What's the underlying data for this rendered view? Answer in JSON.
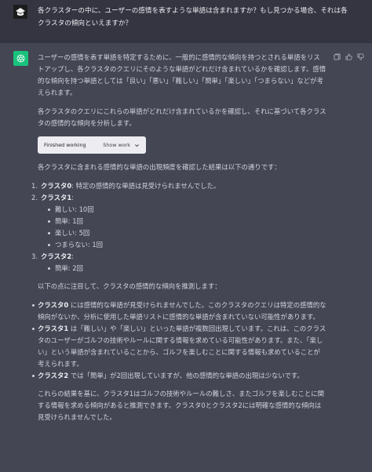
{
  "user": {
    "question": "各クラスターの中に、ユーザーの感情を表すような単語は含まれますか？もし見つかる場合、それは各クラスタの傾向といえますか？"
  },
  "assistant": {
    "intro": "ユーザーの感情を表す単語を特定するために、一般的に感情的な傾向を持つとされる単語をリストアップし、各クラスタのクエリにそのような単語がどれだけ含まれているかを確認します。感情的な傾向を持つ単語としては「良い」「悪い」「難しい」「簡単」「楽しい」「つまらない」などが考えられます。",
    "method": "各クラスタのクエリにこれらの単語がどれだけ含まれているかを確認し、それに基づいて各クラスタの感情的な傾向を分析します。",
    "work_button": {
      "label": "Finished working",
      "show_label": "Show work"
    },
    "results_intro": "各クラスタに含まれる感情的な単語の出現頻度を確認した結果は以下の通りです：",
    "clusters": [
      {
        "num": "1.",
        "name": "クラスタ0",
        "desc": ": 特定の感情的な単語は見受けられませんでした。",
        "words": []
      },
      {
        "num": "2.",
        "name": "クラスタ1",
        "desc": ":",
        "words": [
          "難しい: 10回",
          "簡単: 1回",
          "楽しい: 5回",
          "つまらない: 1回"
        ]
      },
      {
        "num": "3.",
        "name": "クラスタ2",
        "desc": ":",
        "words": [
          "簡単: 2回"
        ]
      }
    ],
    "analysis_intro": "以下の点に注目して、クラスタの感情的な傾向を推測します：",
    "analysis": [
      {
        "name": "クラスタ0",
        "text": " には感情的な単語が見受けられませんでした。このクラスタのクエリは特定の感情的な傾向がないか、分析に使用した単語リストに感情的な単語が含まれていない可能性があります。"
      },
      {
        "name": "クラスタ1",
        "text": " は「難しい」や「楽しい」といった単語が複数回出現しています。これは、このクラスタのユーザーがゴルフの技術やルールに関する情報を求めている可能性があります。また、「楽しい」という単語が含まれていることから、ゴルフを楽しむことに関する情報も求めていることが考えられます。"
      },
      {
        "name": "クラスタ2",
        "text": " では「簡単」が2回出現していますが、他の感情的な単語の出現は少ないです。"
      }
    ],
    "conclusion": "これらの結果を基に、クラスタ1はゴルフの技術やルールの難しさ、またゴルフを楽しむことに関する情報を求める傾向があると推測できます。クラスタ0とクラスタ2には明確な感情的な傾向は見受けられませんでした。"
  }
}
